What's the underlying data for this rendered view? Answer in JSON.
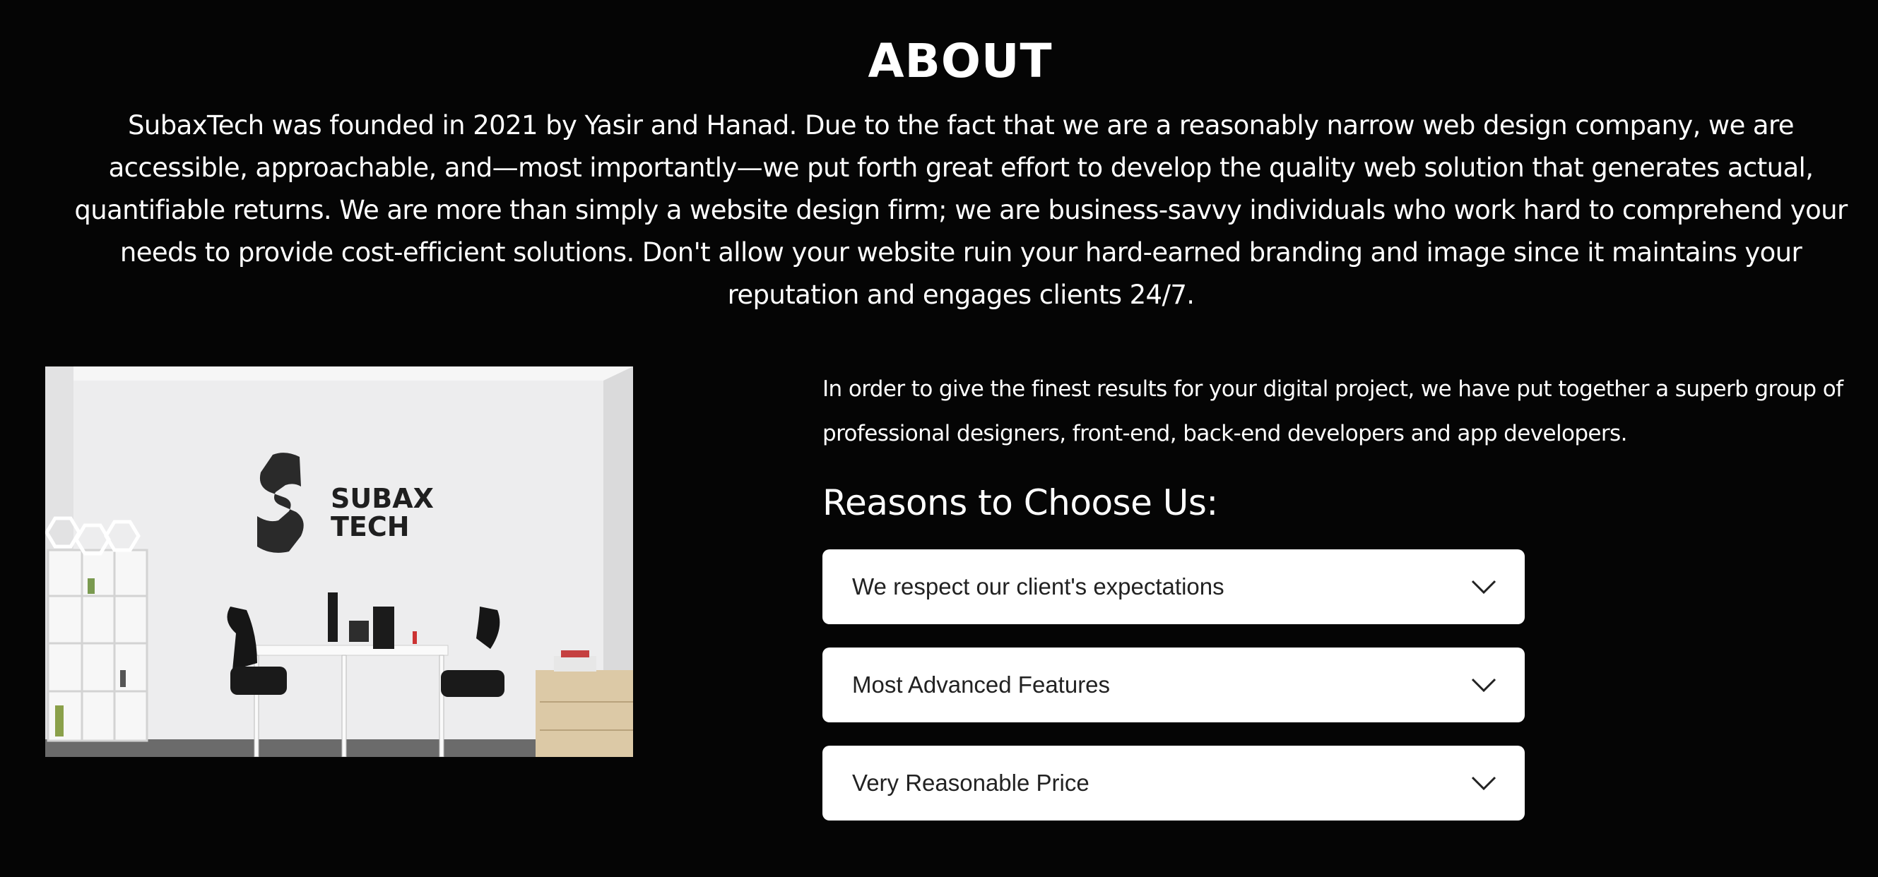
{
  "about": {
    "title": "ABOUT",
    "body": "SubaxTech was founded in 2021 by Yasir and Hanad. Due to the fact that we are a reasonably narrow web design company, we are accessible, approachable, and—most importantly—we put forth great effort to develop the quality web solution that generates actual, quantifiable returns. We are more than simply a website design firm; we are business-savvy individuals who work hard to comprehend your needs to provide cost-efficient solutions. Don't allow your website ruin your hard-earned branding and image since it maintains your reputation and engages clients 24/7."
  },
  "photo": {
    "logo_line1": "SUBAX",
    "logo_line2": "TECH"
  },
  "intro": "In order to give the finest results for your digital project, we have put together a superb group of professional designers, front-end, back-end developers and app developers.",
  "reasons": {
    "heading": "Reasons to Choose Us:",
    "items": [
      {
        "label": "We respect our client's expectations",
        "icon": "chevron-down-icon"
      },
      {
        "label": "Most Advanced Features",
        "icon": "chevron-down-icon"
      },
      {
        "label": "Very Reasonable Price",
        "icon": "chevron-down-icon"
      }
    ]
  },
  "colors": {
    "background": "#050505",
    "text": "#ffffff",
    "card": "#ffffff",
    "card_text": "#222222"
  }
}
